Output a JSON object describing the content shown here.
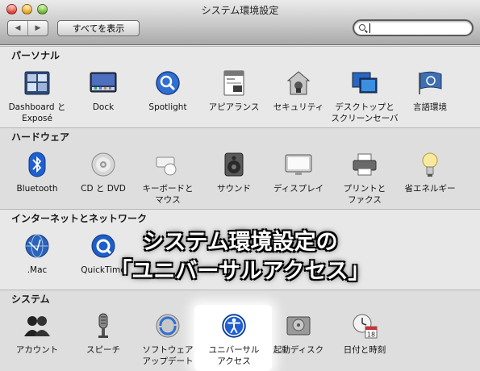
{
  "window": {
    "title": "システム環境設定"
  },
  "toolbar": {
    "back_glyph": "◀",
    "forward_glyph": "▶",
    "show_all_label": "すべてを表示",
    "search_value": "",
    "search_placeholder": ""
  },
  "sections": {
    "personal": {
      "heading": "パーソナル",
      "items": [
        {
          "label": "Dashboard と",
          "label2": "Exposé",
          "icon": "dashboard-expose-icon"
        },
        {
          "label": "Dock",
          "label2": "",
          "icon": "dock-icon"
        },
        {
          "label": "Spotlight",
          "label2": "",
          "icon": "spotlight-icon"
        },
        {
          "label": "アピアランス",
          "label2": "",
          "icon": "appearance-icon"
        },
        {
          "label": "セキュリティ",
          "label2": "",
          "icon": "security-icon"
        },
        {
          "label": "デスクトップと",
          "label2": "スクリーンセーバ",
          "icon": "desktop-screensaver-icon"
        },
        {
          "label": "言語環境",
          "label2": "",
          "icon": "international-icon"
        }
      ]
    },
    "hardware": {
      "heading": "ハードウェア",
      "items": [
        {
          "label": "Bluetooth",
          "label2": "",
          "icon": "bluetooth-icon"
        },
        {
          "label": "CD と DVD",
          "label2": "",
          "icon": "cd-dvd-icon"
        },
        {
          "label": "キーボードと",
          "label2": "マウス",
          "icon": "keyboard-mouse-icon"
        },
        {
          "label": "サウンド",
          "label2": "",
          "icon": "sound-icon"
        },
        {
          "label": "ディスプレイ",
          "label2": "",
          "icon": "display-icon"
        },
        {
          "label": "プリントと",
          "label2": "ファクス",
          "icon": "print-fax-icon"
        },
        {
          "label": "省エネルギー",
          "label2": "",
          "icon": "energy-saver-icon"
        }
      ]
    },
    "internet": {
      "heading": "インターネットとネットワーク",
      "items": [
        {
          "label": ".Mac",
          "label2": "",
          "icon": "dotmac-icon"
        },
        {
          "label": "QuickTime",
          "label2": "",
          "icon": "quicktime-icon"
        }
      ]
    },
    "system": {
      "heading": "システム",
      "items": [
        {
          "label": "アカウント",
          "label2": "",
          "icon": "accounts-icon"
        },
        {
          "label": "スピーチ",
          "label2": "",
          "icon": "speech-icon"
        },
        {
          "label": "ソフトウェア",
          "label2": "アップデート",
          "icon": "software-update-icon"
        },
        {
          "label": "ユニバーサル",
          "label2": "アクセス",
          "icon": "universal-access-icon"
        },
        {
          "label": "起動ディスク",
          "label2": "",
          "icon": "startup-disk-icon"
        },
        {
          "label": "日付と時刻",
          "label2": "",
          "icon": "date-time-icon"
        }
      ]
    }
  },
  "overlay": {
    "line1": "システム環境設定の",
    "line2": "「ユニバーサルアクセス」"
  },
  "calendar_day": "18"
}
